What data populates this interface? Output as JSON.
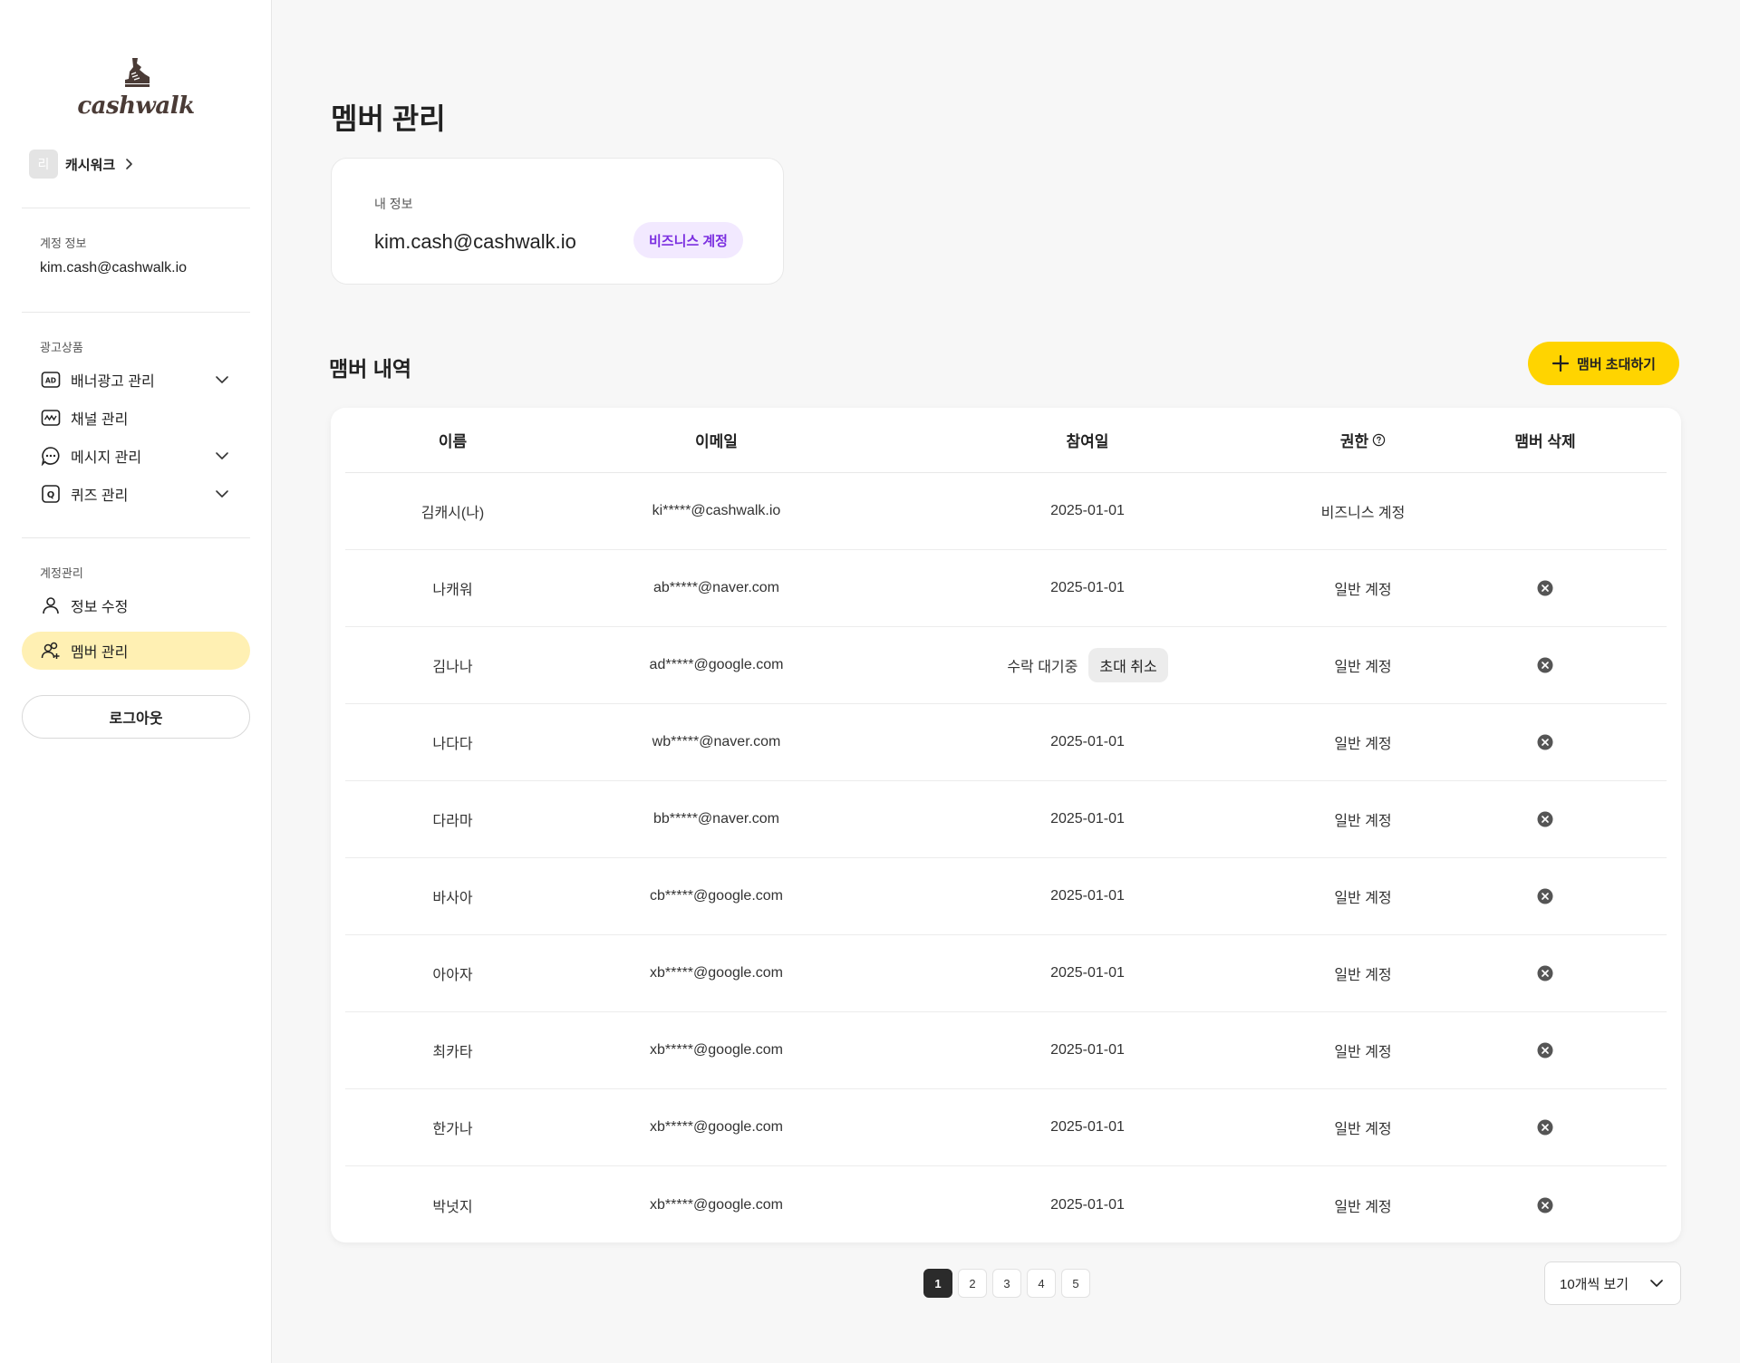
{
  "sidebar": {
    "logo_text": "cashwalk",
    "workspace": {
      "avatar_text": "리",
      "name": "캐시워크"
    },
    "account_section_label": "계정 정보",
    "account_email": "kim.cash@cashwalk.io",
    "ads_section_label": "광고상품",
    "ads_items": [
      {
        "label": "배너광고 관리",
        "icon": "ad-icon",
        "has_chevron": true
      },
      {
        "label": "채널 관리",
        "icon": "channel-icon",
        "has_chevron": false
      },
      {
        "label": "메시지 관리",
        "icon": "message-icon",
        "has_chevron": true
      },
      {
        "label": "퀴즈 관리",
        "icon": "quiz-icon",
        "has_chevron": true
      }
    ],
    "manage_section_label": "계정관리",
    "manage_items": [
      {
        "label": "정보 수정",
        "icon": "user-icon",
        "active": false
      },
      {
        "label": "멤버 관리",
        "icon": "user-add-icon",
        "active": true
      }
    ],
    "logout_label": "로그아웃"
  },
  "main": {
    "page_title": "멤버 관리",
    "my_info": {
      "label": "내 정보",
      "email": "kim.cash@cashwalk.io",
      "badge": "비즈니스 계정"
    },
    "members_title": "맴버 내역",
    "invite_button": "맴버 초대하기",
    "table": {
      "headers": {
        "name": "이름",
        "email": "이메일",
        "date": "참여일",
        "role": "권한",
        "delete": "맴버 삭제"
      },
      "rows": [
        {
          "name": "김캐시(나)",
          "email": "ki*****@cashwalk.io",
          "date": "2025-01-01",
          "role": "비즈니스 계정",
          "deletable": false
        },
        {
          "name": "나캐워",
          "email": "ab*****@naver.com",
          "date": "2025-01-01",
          "role": "일반 계정",
          "deletable": true
        },
        {
          "name": "김나나",
          "email": "ad*****@google.com",
          "pending_text": "수락 대기중",
          "cancel_label": "초대 취소",
          "role": "일반 계정",
          "deletable": true
        },
        {
          "name": "나다다",
          "email": "wb*****@naver.com",
          "date": "2025-01-01",
          "role": "일반 계정",
          "deletable": true
        },
        {
          "name": "다라마",
          "email": "bb*****@naver.com",
          "date": "2025-01-01",
          "role": "일반 계정",
          "deletable": true
        },
        {
          "name": "바사아",
          "email": "cb*****@google.com",
          "date": "2025-01-01",
          "role": "일반 계정",
          "deletable": true
        },
        {
          "name": "아아자",
          "email": "xb*****@google.com",
          "date": "2025-01-01",
          "role": "일반 계정",
          "deletable": true
        },
        {
          "name": "최카타",
          "email": "xb*****@google.com",
          "date": "2025-01-01",
          "role": "일반 계정",
          "deletable": true
        },
        {
          "name": "한가나",
          "email": "xb*****@google.com",
          "date": "2025-01-01",
          "role": "일반 계정",
          "deletable": true
        },
        {
          "name": "박넛지",
          "email": "xb*****@google.com",
          "date": "2025-01-01",
          "role": "일반 계정",
          "deletable": true
        }
      ]
    },
    "pagination": {
      "pages": [
        "1",
        "2",
        "3",
        "4",
        "5"
      ],
      "current": "1"
    },
    "per_page": "10개씩 보기"
  },
  "colors": {
    "accent_yellow": "#ffd400",
    "active_nav_bg": "#fff0b3",
    "badge_bg": "#f2e9ff",
    "badge_text": "#7b2fe0"
  }
}
